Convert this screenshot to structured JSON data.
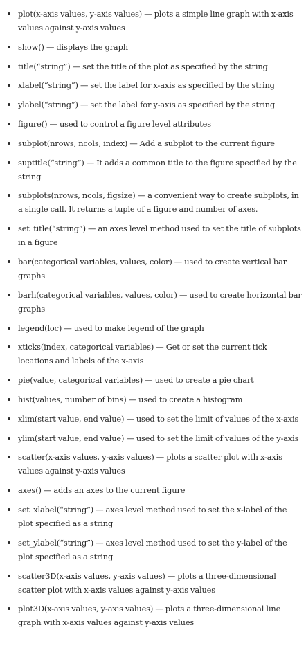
{
  "items": [
    "plot(x-axis values, y-axis values) — plots a simple line graph with x-axis values against y-axis values",
    "show() — displays the graph",
    "title(“string”) — set the title of the plot as specified by the string",
    "xlabel(“string”) — set the label for x-axis as specified by the string",
    "ylabel(“string”) — set the label for y-axis as specified by the string",
    "figure() — used to control a figure level attributes",
    "subplot(nrows, ncols, index) — Add a subplot to the current figure",
    "suptitle(“string”) — It adds a common title to the figure specified by the string",
    "subplots(nrows, ncols, figsize) — a convenient way to create subplots, in a single call. It returns a tuple of a figure and number of axes.",
    "set_title(“string”) — an axes level method used to set the title of subplots in a figure",
    "bar(categorical variables, values, color) — used to create vertical bar graphs",
    "barh(categorical variables, values, color) — used to create horizontal bar graphs",
    "legend(loc) — used to make legend of the graph",
    "xticks(index, categorical variables) — Get or set the current tick locations and labels of the x-axis",
    "pie(value, categorical variables) — used to create a pie chart",
    "hist(values, number of bins) — used to create a histogram",
    "xlim(start value, end value) — used to set the limit of values of the x-axis",
    "ylim(start value, end value) — used to set the limit of values of the y-axis",
    "scatter(x-axis values, y-axis values) — plots a scatter plot with x-axis values against y-axis values",
    "axes() — adds an axes to the current figure",
    "set_xlabel(“string”) — axes level method used to set the x-label of the plot specified as a string",
    "set_ylabel(“string”) — axes level method used to set the y-label of the plot specified as a string",
    "scatter3D(x-axis values, y-axis values) — plots a three-dimensional scatter plot with x-axis values against y-axis values",
    "plot3D(x-axis values, y-axis values) — plots a three-dimensional line graph with x-axis values against y-axis values"
  ]
}
